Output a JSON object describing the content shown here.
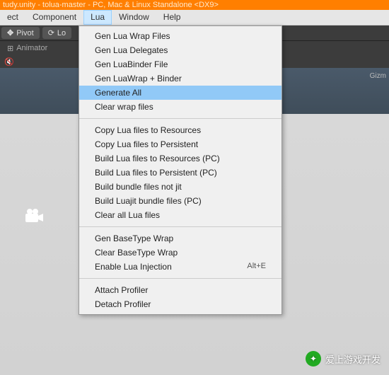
{
  "title": "tudy.unity - tolua-master - PC, Mac & Linux Standalone <DX9>",
  "menubar": {
    "items": [
      "ect",
      "Component",
      "Lua",
      "Window",
      "Help"
    ],
    "openIndex": 2
  },
  "toolbar": {
    "pivot": "Pivot",
    "local": "Lo"
  },
  "toolbar2": {
    "animator": "Animator"
  },
  "viewport": {
    "gizmo": "Gizm"
  },
  "dropdown": {
    "groups": [
      [
        {
          "label": "Gen Lua Wrap Files"
        },
        {
          "label": "Gen Lua Delegates"
        },
        {
          "label": "Gen LuaBinder File"
        },
        {
          "label": "Gen LuaWrap + Binder"
        },
        {
          "label": "Generate All",
          "hl": true
        },
        {
          "label": "Clear wrap files"
        }
      ],
      [
        {
          "label": "Copy Lua  files to Resources"
        },
        {
          "label": "Copy Lua  files to Persistent"
        },
        {
          "label": "Build Lua files to Resources (PC)"
        },
        {
          "label": "Build Lua files to Persistent (PC)"
        },
        {
          "label": "Build bundle files not jit"
        },
        {
          "label": "Build Luajit bundle files   (PC)"
        },
        {
          "label": "Clear all Lua files"
        }
      ],
      [
        {
          "label": "Gen BaseType Wrap"
        },
        {
          "label": "Clear BaseType Wrap"
        },
        {
          "label": "Enable Lua Injection",
          "shortcut": "Alt+E"
        }
      ],
      [
        {
          "label": "Attach Profiler"
        },
        {
          "label": "Detach Profiler"
        }
      ]
    ]
  },
  "watermark": {
    "text": "爱上游戏开发"
  }
}
